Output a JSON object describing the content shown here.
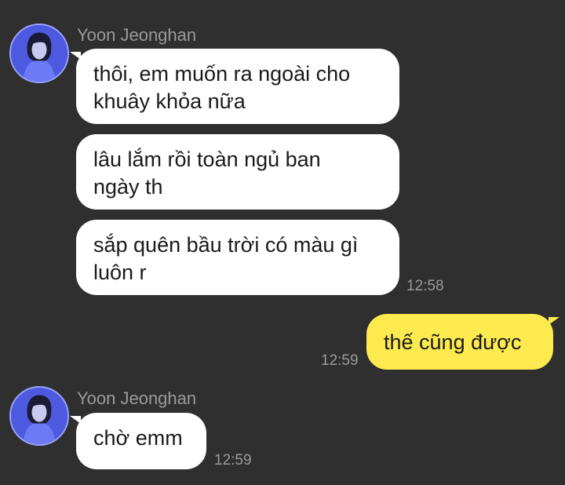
{
  "conversation": {
    "groups": [
      {
        "sender": "Yoon Jeonghan",
        "messages": [
          "thôi, em muốn ra ngoài cho\nkhuây khỏa nữa",
          "lâu lắm rồi toàn ngủ ban\nngày th",
          "sắp quên bầu trời có màu gì\nluôn r"
        ],
        "time": "12:58"
      },
      {
        "sender": "me",
        "messages": [
          "thế cũng được"
        ],
        "time": "12:59"
      },
      {
        "sender": "Yoon Jeonghan",
        "messages": [
          "chờ emm"
        ],
        "time": "12:59"
      }
    ]
  },
  "colors": {
    "background": "#2f2f2f",
    "incoming_bubble": "#ffffff",
    "outgoing_bubble": "#fdea4f",
    "meta_text": "#9a9a9a"
  },
  "icons": {
    "avatar": "profile-photo"
  }
}
